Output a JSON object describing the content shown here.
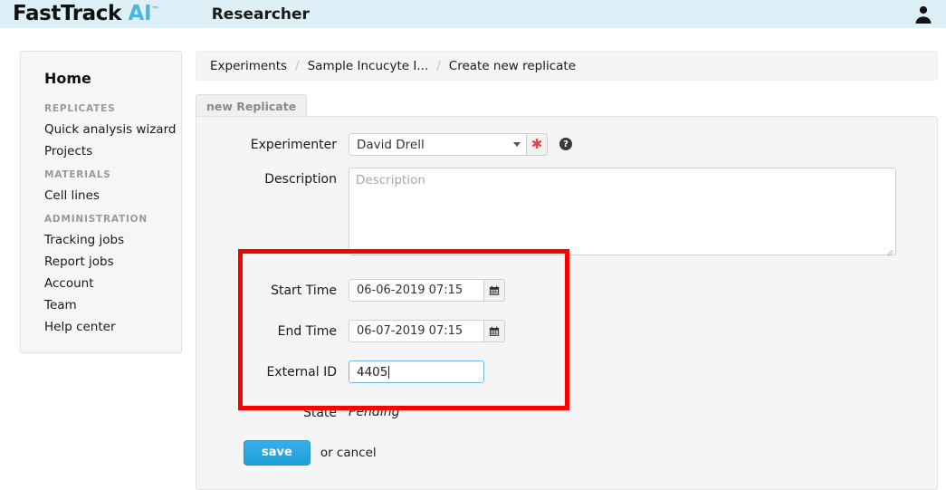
{
  "header": {
    "logo_main": "FastTrack",
    "logo_accent": "AI",
    "logo_tm": "™",
    "role_title": "Researcher",
    "user_icon": "user-avatar-icon"
  },
  "sidebar": {
    "home_label": "Home",
    "groups": [
      {
        "title": "REPLICATES",
        "items": [
          "Quick analysis wizard",
          "Projects"
        ]
      },
      {
        "title": "MATERIALS",
        "items": [
          "Cell lines"
        ]
      },
      {
        "title": "ADMINISTRATION",
        "items": [
          "Tracking jobs",
          "Report jobs",
          "Account",
          "Team",
          "Help center"
        ]
      }
    ]
  },
  "breadcrumb": {
    "items": [
      "Experiments",
      "Sample Incucyte I...",
      "Create new replicate"
    ],
    "separator": "/"
  },
  "panel": {
    "tab_label": "new Replicate",
    "fields": {
      "experimenter": {
        "label": "Experimenter",
        "value": "David Drell",
        "required_marker": "✱",
        "help_glyph": "?"
      },
      "description": {
        "label": "Description",
        "placeholder": "Description",
        "value": ""
      },
      "start_time": {
        "label": "Start Time",
        "value": "06-06-2019 07:15",
        "calendar_icon": "calendar-icon"
      },
      "end_time": {
        "label": "End Time",
        "value": "06-07-2019 07:15",
        "calendar_icon": "calendar-icon"
      },
      "external_id": {
        "label": "External ID",
        "value": "4405"
      },
      "state": {
        "label": "State",
        "value": "Pending"
      }
    },
    "actions": {
      "save_label": "save",
      "or_text": "or ",
      "cancel_label": "cancel"
    }
  },
  "colors": {
    "header_bg": "#ddeff7",
    "logo_accent": "#49b6e3",
    "save_button": "#1d9fdb",
    "highlight_box": "#fb0000",
    "required_marker": "#e04646",
    "focus_border": "#72b8e8"
  }
}
